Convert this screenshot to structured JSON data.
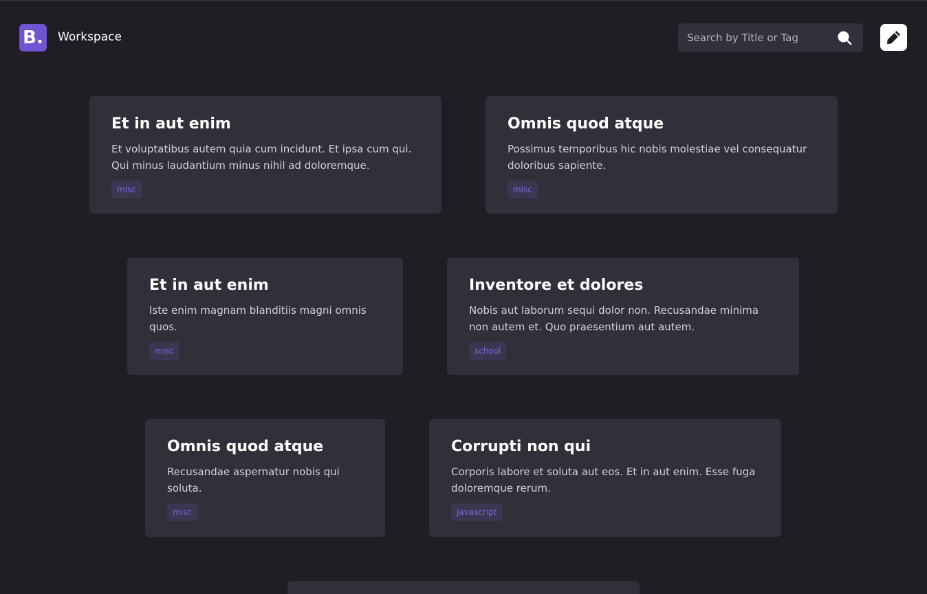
{
  "header": {
    "logo_text": "B.",
    "brand": "Workspace",
    "search_placeholder": "Search by Title or Tag",
    "search_value": ""
  },
  "cards": [
    {
      "title": "Et in aut enim",
      "text": "Et voluptatibus autem quia cum incidunt. Et ipsa cum qui. Qui minus laudantium minus nihil ad doloremque.",
      "tag": "misc"
    },
    {
      "title": "Omnis quod atque",
      "text": "Possimus temporibus hic nobis molestiae vel consequatur doloribus sapiente.",
      "tag": "misc"
    },
    {
      "title": "Et in aut enim",
      "text": "Iste enim magnam blanditiis magni omnis quos.",
      "tag": "misc"
    },
    {
      "title": "Inventore et dolores",
      "text": "Nobis aut laborum sequi dolor non. Recusandae minima non autem et. Quo praesentium aut autem.",
      "tag": "school"
    },
    {
      "title": "Omnis quod atque",
      "text": "Recusandae aspernatur nobis qui soluta.",
      "tag": "misc"
    },
    {
      "title": "Corrupti non qui",
      "text": "Corporis labore et soluta aut eos. Et in aut enim. Esse fuga doloremque rerum.",
      "tag": "javascript"
    }
  ],
  "colors": {
    "background": "#201d24",
    "card": "#332f38",
    "accent": "#6f54d3",
    "tag_bg": "#3c3653",
    "tag_text": "#7c68d8"
  },
  "icons": {
    "search": "search-icon",
    "edit": "pencil-icon"
  }
}
